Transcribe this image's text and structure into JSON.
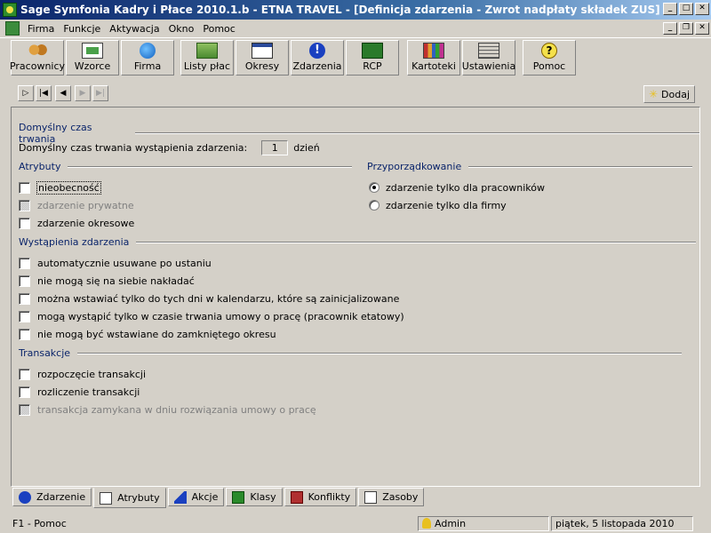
{
  "window": {
    "title": "Sage Symfonia Kadry i Płace 2010.1.b - ETNA TRAVEL - [Definicja zdarzenia - Zwrot nadpłaty składek ZUS]"
  },
  "menu": [
    "Firma",
    "Funkcje",
    "Aktywacja",
    "Okno",
    "Pomoc"
  ],
  "toolbar": {
    "pracownicy": "Pracownicy",
    "wzorce": "Wzorce",
    "firma": "Firma",
    "listy_plac": "Listy płac",
    "okresy": "Okresy",
    "zdarzenia": "Zdarzenia",
    "rcp": "RCP",
    "kartoteki": "Kartoteki",
    "ustawienia": "Ustawienia",
    "pomoc": "Pomoc"
  },
  "nav": {
    "add_label": "Dodaj"
  },
  "form": {
    "default_duration": {
      "section": "Domyślny czas trwania",
      "label": "Domyślny czas trwania wystąpienia zdarzenia:",
      "value": "1",
      "unit": "dzień"
    },
    "attributes": {
      "section": "Atrybuty",
      "items": [
        "nieobecność",
        "zdarzenie prywatne",
        "zdarzenie okresowe"
      ]
    },
    "assignment": {
      "section": "Przyporządkowanie",
      "options": [
        "zdarzenie tylko dla pracowników",
        "zdarzenie tylko dla firmy"
      ],
      "selected": "zdarzenie tylko dla pracowników"
    },
    "occurrences": {
      "section": "Wystąpienia zdarzenia",
      "items": [
        "automatycznie usuwane po ustaniu",
        "nie mogą się na siebie nakładać",
        "można wstawiać tylko do tych dni w kalendarzu, które są zainicjalizowane",
        "mogą wystąpić tylko w czasie trwania umowy o pracę (pracownik etatowy)",
        "nie mogą być wstawiane do zamkniętego okresu"
      ]
    },
    "transactions": {
      "section": "Transakcje",
      "items": [
        "rozpoczęcie transakcji",
        "rozliczenie transakcji",
        "transakcja zamykana w dniu rozwiązania umowy o pracę"
      ]
    }
  },
  "tabs": [
    "Zdarzenie",
    "Atrybuty",
    "Akcje",
    "Klasy",
    "Konflikty",
    "Zasoby"
  ],
  "active_tab": "Atrybuty",
  "status": {
    "help": "F1 - Pomoc",
    "user": "Admin",
    "date": "piątek, 5 listopada 2010"
  }
}
